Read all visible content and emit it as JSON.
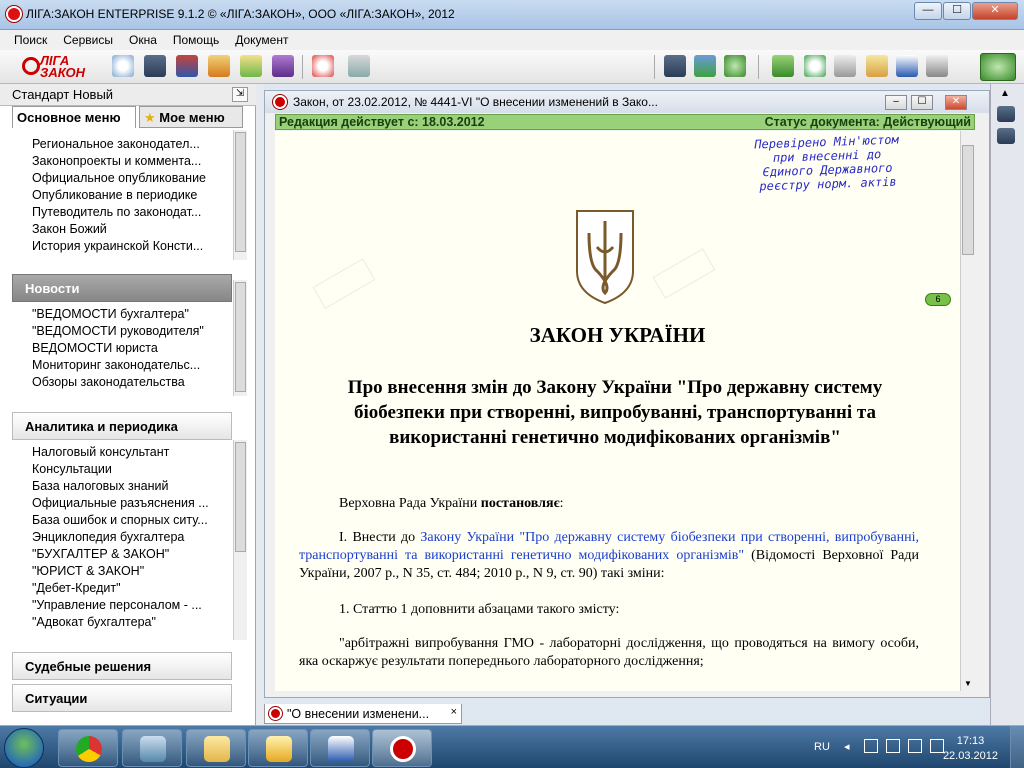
{
  "window": {
    "title": "ЛІГА:ЗАКОН ENTERPRISE 9.1.2 © «ЛІГА:ЗАКОН», ООО «ЛІГА:ЗАКОН», 2012"
  },
  "menu": [
    "Поиск",
    "Сервисы",
    "Окна",
    "Помощь",
    "Документ"
  ],
  "logo": {
    "line1": "ЛІГА",
    "line2": "ЗАКОН"
  },
  "sidebar": {
    "profile": "Стандарт Новый",
    "tabs": {
      "main": "Основное меню",
      "my": "Мое меню"
    },
    "top_items": [
      "Региональное законодател...",
      "Законопроекты и коммента...",
      "Официальное опубликование",
      "Опубликование в периодике",
      "Путеводитель по законодат...",
      "Закон Божий",
      "История украинской Консти..."
    ],
    "news_header": "Новости",
    "news_items": [
      "\"ВЕДОМОСТИ бухгалтера\"",
      "\"ВЕДОМОСТИ руководителя\"",
      "ВЕДОМОСТИ юриста",
      "Мониторинг законодательс...",
      "Обзоры законодательства"
    ],
    "analytics_header": "Аналитика и периодика",
    "analytics_items": [
      "Налоговый консультант",
      "Консультации",
      "База налоговых знаний",
      "Официальные разъяснения ...",
      "База ошибок и спорных ситу...",
      "Энциклопедия бухгалтера",
      "\"БУХГАЛТЕР & ЗАКОН\"",
      "\"ЮРИСТ & ЗАКОН\"",
      "\"Дебет-Кредит\"",
      "\"Управление персоналом - ...",
      "\"Адвокат бухгалтера\""
    ],
    "court_header": "Судебные решения",
    "situations_header": "Ситуации"
  },
  "document": {
    "window_title": "Закон, от 23.02.2012, № 4441-VI \"О внесении изменений в Зако...",
    "status_left": "Редакция действует с: 18.03.2012",
    "status_right": "Статус документа: Действующий",
    "stamp_lines": [
      "Перевірено Мін'юстом",
      "при внесенні до",
      "Єдиного Державного",
      "реєстру норм. актів"
    ],
    "badge": "6",
    "law_title": "ЗАКОН УКРАЇНИ",
    "law_subtitle": "Про внесення змін до Закону України \"Про державну систему біобезпеки при створенні, випробуванні, транспортуванні та використанні генетично модифікованих організмів\"",
    "para1_a": "Верховна Рада України ",
    "para1_b": "постановляє",
    "para1_c": ":",
    "para2_a": "I. Внести до ",
    "para2_link": "Закону України \"Про державну систему біобезпеки при створенні, випробуванні, транспортуванні та використанні генетично модифікованих організмів\"",
    "para2_b": " (Відомості Верховної Ради України, 2007 р., N 35, ст. 484; 2010 р., N 9, ст. 90) такі зміни:",
    "para3": "1. Статтю 1 доповнити абзацами такого змісту:",
    "para4": "\"арбітражні випробування ГМО - лабораторні дослідження, що проводяться на вимогу особи, яка оскаржує результати попереднього лабораторного дослідження;"
  },
  "bottom_tab": {
    "label": "\"О внесении изменени...",
    "close": "×"
  },
  "taskbar": {
    "lang": "RU",
    "time": "17:13",
    "date": "22.03.2012"
  },
  "colors": {
    "status_green": "#99d17a",
    "link_blue": "#1a3ed0",
    "stamp_blue": "#2a2ac8",
    "brand_red": "#cc0000"
  }
}
